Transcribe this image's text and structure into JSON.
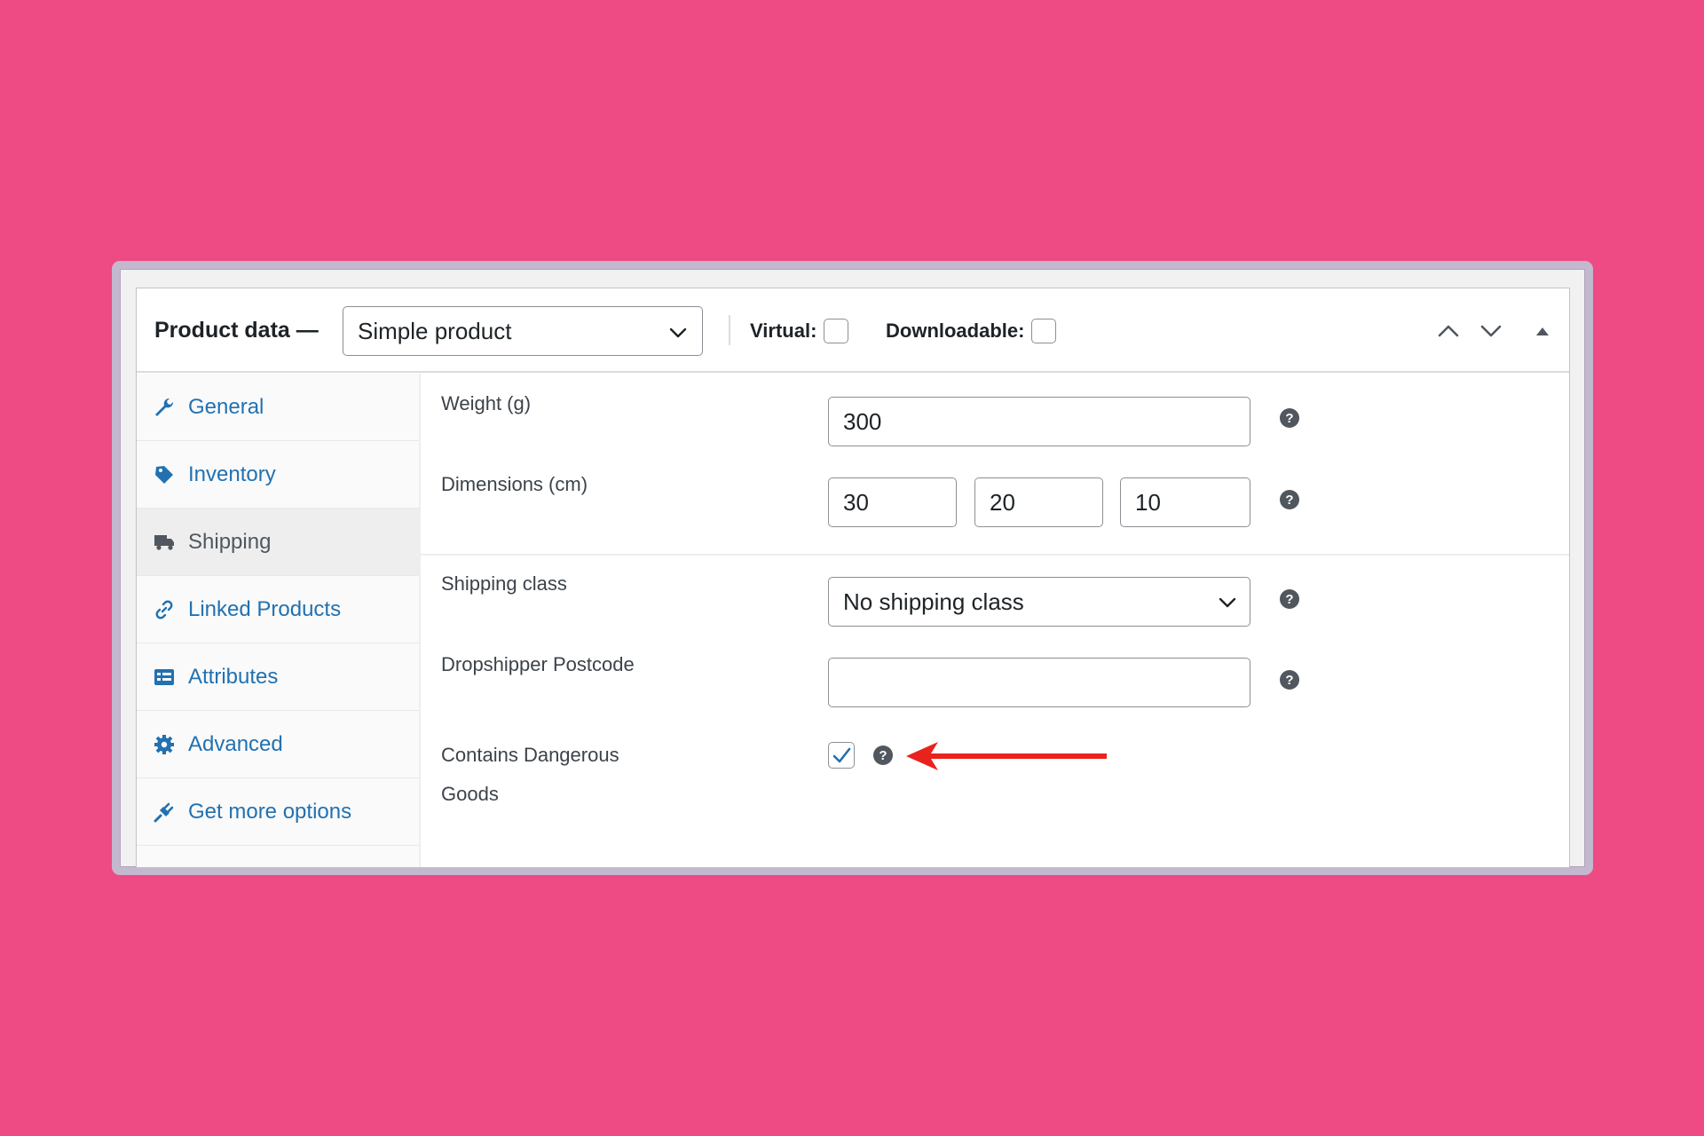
{
  "header": {
    "title": "Product data —",
    "product_type": "Simple product",
    "virtual_label": "Virtual:",
    "virtual_checked": false,
    "downloadable_label": "Downloadable:",
    "downloadable_checked": false
  },
  "tabs": [
    {
      "label": "General",
      "icon": "wrench-icon",
      "active": false
    },
    {
      "label": "Inventory",
      "icon": "tag-icon",
      "active": false
    },
    {
      "label": "Shipping",
      "icon": "truck-icon",
      "active": true
    },
    {
      "label": "Linked Products",
      "icon": "link-icon",
      "active": false
    },
    {
      "label": "Attributes",
      "icon": "list-icon",
      "active": false
    },
    {
      "label": "Advanced",
      "icon": "gear-icon",
      "active": false
    },
    {
      "label": "Get more options",
      "icon": "plugin-icon",
      "active": false
    }
  ],
  "fields": {
    "weight": {
      "label": "Weight (g)",
      "value": "300"
    },
    "dimensions": {
      "label": "Dimensions (cm)",
      "length": "30",
      "width": "20",
      "height": "10"
    },
    "shipping_class": {
      "label": "Shipping class",
      "value": "No shipping class"
    },
    "dropshipper_postcode": {
      "label": "Dropshipper Postcode",
      "value": ""
    },
    "dangerous_goods": {
      "label_line1": "Contains Dangerous",
      "label_line2": "Goods",
      "checked": true
    }
  },
  "colors": {
    "background": "#ee4a84",
    "link": "#2271b1",
    "annotation_arrow": "#e8231d",
    "checkbox_check": "#2271b1"
  }
}
